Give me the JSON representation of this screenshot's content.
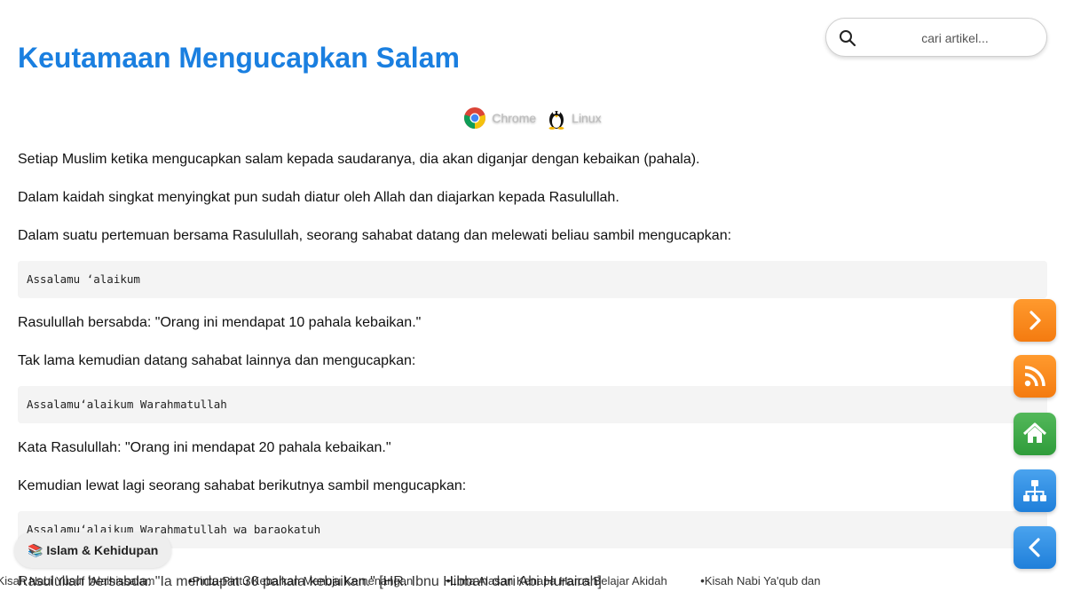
{
  "article": {
    "title": "Keutamaan Mengucapkan Salam",
    "paragraphs": {
      "p1": "Setiap Muslim ketika mengucapkan salam kepada saudaranya, dia akan diganjar dengan kebaikan (pahala).",
      "p2": "Dalam kaidah singkat menyingkat pun sudah diatur oleh Allah dan diajarkan kepada Rasulullah.",
      "p3": "Dalam suatu pertemuan bersama Rasulullah, seorang sahabat datang dan melewati beliau sambil mengucapkan:",
      "p4": "Rasulullah bersabda: \"Orang ini mendapat 10 pahala kebaikan.\"",
      "p5": "Tak lama kemudian datang sahabat lainnya dan mengucapkan:",
      "p6": "Kata Rasulullah: \"Orang ini mendapat 20 pahala kebaikan.\"",
      "p7": "Kemudian lewat lagi seorang sahabat berikutnya sambil mengucapkan:",
      "p8": "Rasulullah bersabda: \"Ia mendapat 30 pahala kebaikan.\" [HR. Ibnu Hibban dari Abi Hurairah]"
    },
    "code": {
      "c1": "Assalamu ‘alaikum",
      "c2": "Assalamu‘alaikum Warahmatullah",
      "c3": "Assalamu‘alaikum Warahmatullah wa baraokatuh"
    }
  },
  "search": {
    "placeholder": "cari artikel..."
  },
  "browsers": {
    "chrome": "Chrome",
    "linux": "Linux"
  },
  "category_chip": {
    "label": "📚 Islam & Kehidupan"
  },
  "ticker": {
    "items": [
      "Kisah Nabi Yusuf 'Alaihissalam",
      "Pintu-Pintu Kebaikan Menuju Kemenangan",
      "Lima Alasan Kenapa Harus Belajar Akidah",
      "Kisah Nabi Ya'qub dan"
    ]
  },
  "fab_buttons": {
    "next": "chevron-right-icon",
    "rss": "rss-icon",
    "home": "home-icon",
    "sitemap": "sitemap-icon",
    "back": "chevron-left-icon"
  },
  "colors": {
    "title": "#1a7fe0",
    "orange": "#f47b10",
    "green": "#2f9c3a",
    "blue": "#1f7fda"
  }
}
